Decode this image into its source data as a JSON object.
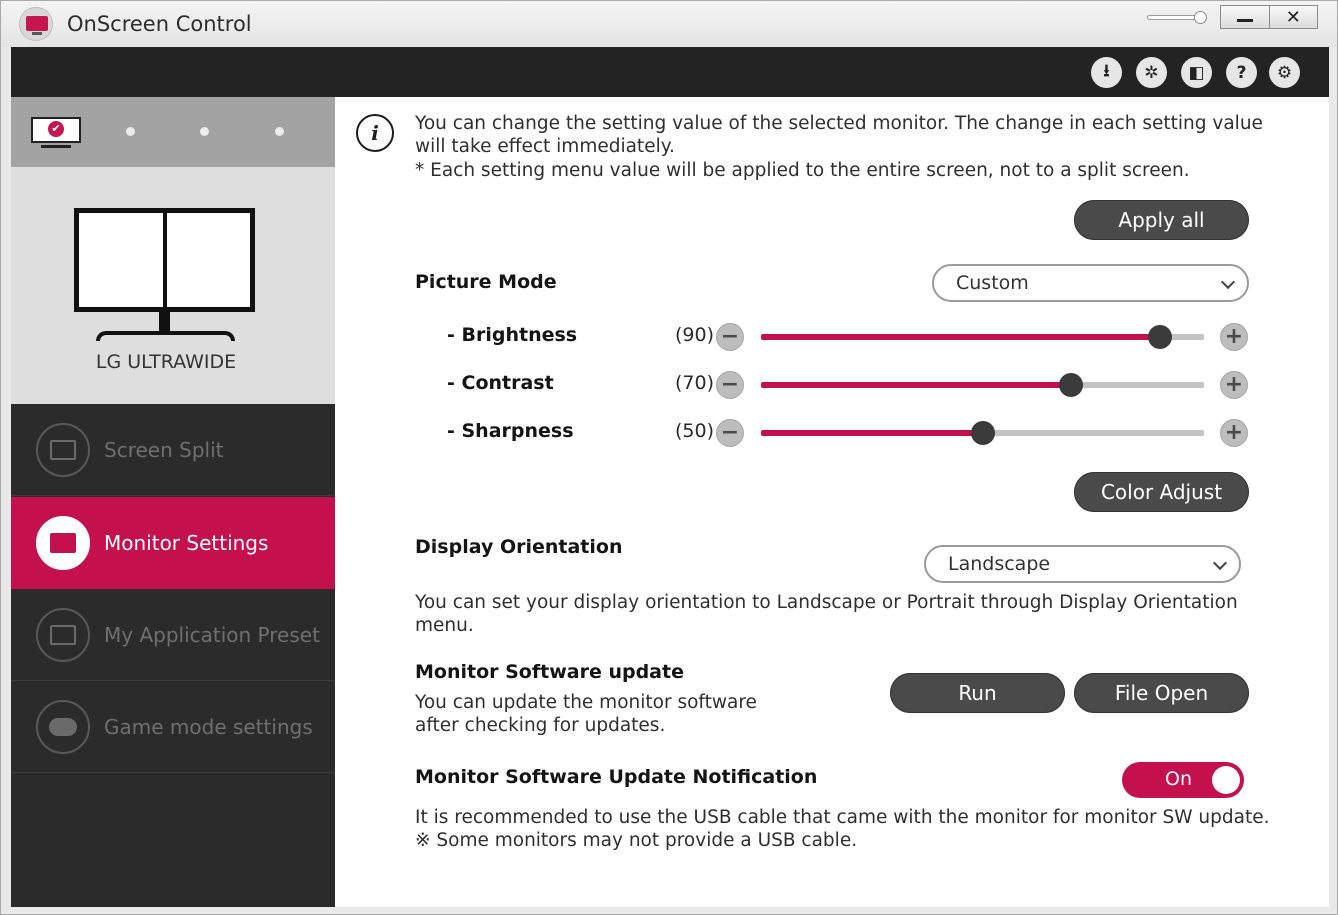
{
  "window": {
    "title": "OnScreen Control",
    "minimize_label": "",
    "close_label": "✕"
  },
  "toolbar": {
    "buttons": [
      {
        "name": "download-icon",
        "glyph": "⭳"
      },
      {
        "name": "cursor-click-icon",
        "glyph": "✲"
      },
      {
        "name": "screen-split-icon",
        "glyph": "◧"
      },
      {
        "name": "help-icon",
        "glyph": "?"
      },
      {
        "name": "gear-icon",
        "glyph": "⚙"
      }
    ]
  },
  "sidebar": {
    "monitor_name": "LG ULTRAWIDE",
    "check_glyph": "✔",
    "items": [
      {
        "label": "Screen Split",
        "icon": "screen-split-icon",
        "active": false
      },
      {
        "label": "Monitor Settings",
        "icon": "monitor-settings-icon",
        "active": true
      },
      {
        "label": "My Application Preset",
        "icon": "application-preset-icon",
        "active": false
      },
      {
        "label": "Game mode settings",
        "icon": "gamepad-icon",
        "active": false
      }
    ]
  },
  "main": {
    "info_glyph": "i",
    "info_line1": "You can change the setting value of the selected monitor. The change in each setting value",
    "info_line2": "will take effect immediately.",
    "info_line3": "* Each setting menu value will be applied to the entire screen, not to a split screen.",
    "apply_all": "Apply all",
    "picture_mode": {
      "label": "Picture Mode",
      "value": "Custom"
    },
    "sliders": [
      {
        "label": "- Brightness",
        "value_text": "(90)",
        "value": 90,
        "min_glyph": "−",
        "max_glyph": "+"
      },
      {
        "label": "- Contrast",
        "value_text": "(70)",
        "value": 70,
        "min_glyph": "−",
        "max_glyph": "+"
      },
      {
        "label": "- Sharpness",
        "value_text": "(50)",
        "value": 50,
        "min_glyph": "−",
        "max_glyph": "+"
      }
    ],
    "color_adjust": "Color Adjust",
    "orientation": {
      "label": "Display Orientation",
      "value": "Landscape",
      "desc_line1": "You can set your display orientation to Landscape or Portrait through Display Orientation",
      "desc_line2": "menu."
    },
    "sw_update": {
      "label": "Monitor Software update",
      "desc_line1": "You can update the monitor software",
      "desc_line2": "after checking for updates.",
      "run": "Run",
      "file_open": "File Open"
    },
    "sw_notification": {
      "label": "Monitor Software Update Notification",
      "toggle": "On",
      "toggle_on": true,
      "desc_line1": "It is recommended to use the USB cable that came with the monitor for monitor SW update.",
      "desc_line2": "※ Some monitors may not provide a USB cable."
    }
  },
  "colors": {
    "accent": "#c5104e",
    "dark": "#232323",
    "button": "#4a4a4a"
  }
}
